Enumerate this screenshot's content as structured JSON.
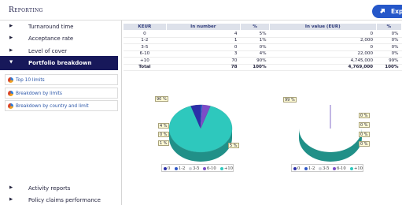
{
  "header": {
    "title": "Reporting",
    "export_label": "Export"
  },
  "sidebar": {
    "items": [
      {
        "label": "Turnaround time"
      },
      {
        "label": "Acceptance rate"
      },
      {
        "label": "Level of cover"
      },
      {
        "label": "Portfolio breakdown"
      }
    ],
    "subitems": [
      {
        "label": "Top 10 limits"
      },
      {
        "label": "Breakdown by limits"
      },
      {
        "label": "Breakdown by country and limit"
      }
    ],
    "bottom_items": [
      {
        "label": "Activity reports"
      },
      {
        "label": "Policy claims performance"
      }
    ]
  },
  "table": {
    "headers": [
      "KEUR",
      "In number",
      "%",
      "In value (EUR)",
      "%"
    ],
    "rows": [
      [
        "0",
        "4",
        "5%",
        "0",
        "0%"
      ],
      [
        "1-2",
        "1",
        "1%",
        "2,000",
        "0%"
      ],
      [
        "3-5",
        "0",
        "0%",
        "0",
        "0%"
      ],
      [
        "6-10",
        "3",
        "4%",
        "22,000",
        "0%"
      ],
      [
        "+10",
        "70",
        "90%",
        "4,745,000",
        "99%"
      ],
      [
        "Total",
        "78",
        "100%",
        "4,769,000",
        "100%"
      ]
    ]
  },
  "colors": {
    "accent": "#2557c9",
    "nav_active": "#17185a",
    "pie_main": "#2ec8bd",
    "series": [
      "#2b2fa8",
      "#2f58c8",
      "#cfd2d8",
      "#7d4cc8",
      "#2ec8bd"
    ]
  },
  "chart_data": [
    {
      "type": "pie",
      "categories": [
        "0",
        "1-2",
        "3-5",
        "6-10",
        "+10"
      ],
      "values": [
        5,
        1,
        0,
        4,
        90
      ],
      "labels": [
        "5 %",
        "1 %",
        "0 %",
        "4 %",
        "90 %"
      ],
      "legend": "bottom"
    },
    {
      "type": "pie",
      "categories": [
        "0",
        "1-2",
        "3-5",
        "6-10",
        "+10"
      ],
      "values": [
        0,
        0,
        0,
        0,
        99
      ],
      "labels": [
        "0 %",
        "0 %",
        "0 %",
        "0 %",
        "99 %"
      ],
      "legend": "bottom"
    }
  ]
}
